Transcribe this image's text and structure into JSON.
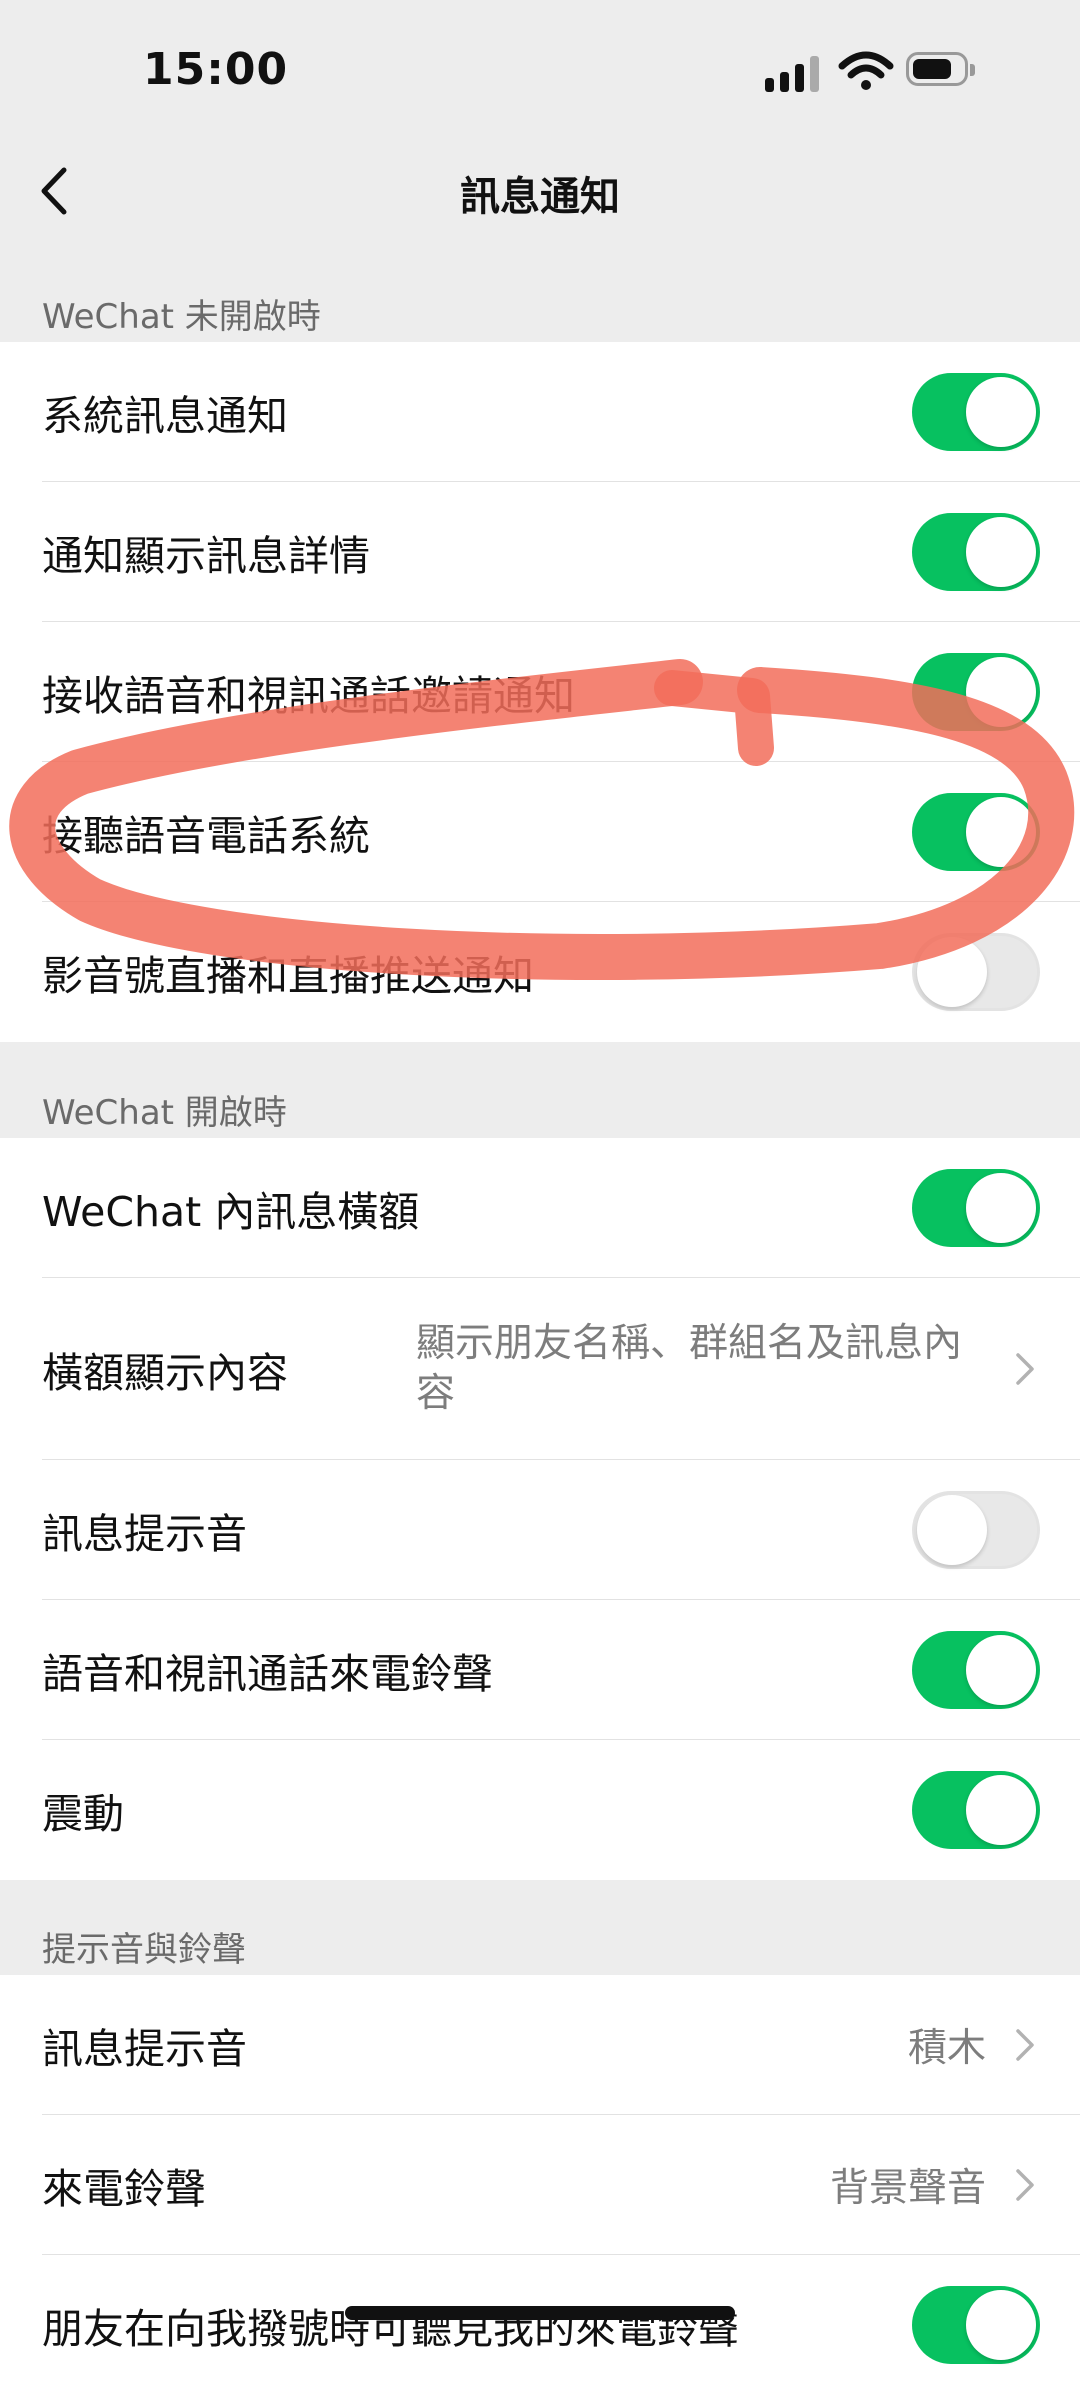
{
  "status_bar": {
    "time": "15:00"
  },
  "nav": {
    "title": "訊息通知"
  },
  "sections": [
    {
      "header": "WeChat 未開啟時",
      "rows": [
        {
          "label": "系統訊息通知",
          "toggle": "on"
        },
        {
          "label": "通知顯示訊息詳情",
          "toggle": "on"
        },
        {
          "label": "接收語音和視訊通話邀請通知",
          "toggle": "on"
        },
        {
          "label": "接聽語音電話系統",
          "toggle": "on"
        },
        {
          "label": "影音號直播和直播推送通知",
          "toggle": "off"
        }
      ]
    },
    {
      "header": "WeChat 開啟時",
      "rows": [
        {
          "label": "WeChat 內訊息橫額",
          "toggle": "on"
        },
        {
          "label": "橫額顯示內容",
          "value": "顯示朋友名稱、群組名及訊息內容"
        },
        {
          "label": "訊息提示音",
          "toggle": "off"
        },
        {
          "label": "語音和視訊通話來電鈴聲",
          "toggle": "on"
        },
        {
          "label": "震動",
          "toggle": "on"
        }
      ]
    },
    {
      "header": "提示音與鈴聲",
      "rows": [
        {
          "label": "訊息提示音",
          "value": "積木"
        },
        {
          "label": "來電鈴聲",
          "value": "背景聲音"
        },
        {
          "label": "朋友在向我撥號時可聽見我的來電鈴聲",
          "toggle": "on"
        }
      ]
    }
  ],
  "colors": {
    "toggle_on": "#07c160",
    "toggle_off": "#e8e8e8",
    "annotation": "#f26d5b",
    "background": "#ededed"
  },
  "icons": {
    "back": "chevron-left",
    "disclosure": "chevron-right",
    "signal": "cellular-signal",
    "wifi": "wifi",
    "battery": "battery"
  }
}
